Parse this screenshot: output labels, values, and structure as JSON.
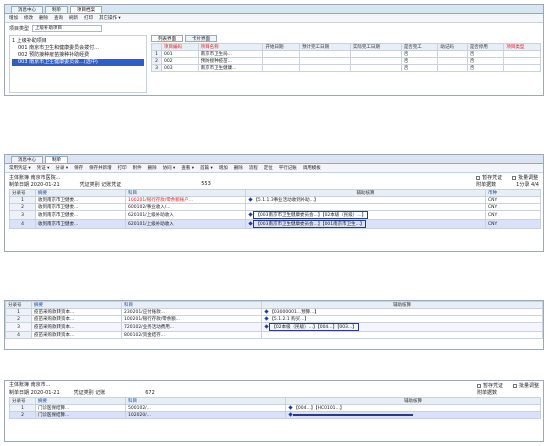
{
  "panel1": {
    "tabs": [
      "消息中心",
      "制单",
      "项目档案"
    ],
    "toolbar": [
      "增加",
      "修改",
      "删除",
      "查询",
      "刷新",
      "打印",
      "其它操作 ▾"
    ],
    "project_type_label": "项目类型",
    "project_type_value": "上级补助项目",
    "tree": [
      "1 上级补助项目",
      "001 南京市卫生和健康委员会拨付...",
      "002 预防接种疫苗接种补助经费",
      "003 南京市卫生健康委员会...(选中)"
    ],
    "subtabs": [
      "列表界面",
      "卡片界面"
    ],
    "grid_headers": [
      "项目编码",
      "项目名称",
      "开始日期",
      "预计完工日期",
      "实际完工日期",
      "是否完工",
      "助记码",
      "是否停用",
      "项目类型"
    ],
    "rows": [
      {
        "n": "1",
        "code": "001",
        "name": "南京市卫生局...",
        "flag": "否"
      },
      {
        "n": "2",
        "code": "002",
        "name": "预防接种疫苗...",
        "flag": "否"
      },
      {
        "n": "3",
        "code": "003",
        "name": "南京市卫生健康...",
        "flag": "否"
      }
    ]
  },
  "panel2": {
    "tabs": [
      "消息中心",
      "制单"
    ],
    "toolbar": [
      "常用凭证 ▾",
      "凭证 ▾",
      "分录 ▾",
      "保存",
      "保存并新增",
      "打印",
      "附件",
      "删除",
      "协同 ▾",
      "查看 ▾",
      "首篇 ▾",
      "增加",
      "删除",
      "流程",
      "定位",
      "平行记账",
      "调用模板"
    ],
    "entity": "主体账簿  南京市医院...",
    "date": "制单日期  2020-01-21",
    "doc_type": "凭证类别  记账凭证",
    "count": "553",
    "checkbox1": "暂存凭证",
    "checkbox2": "批量调整",
    "attach": "附单据数",
    "page": "1分录  4/4",
    "headers": [
      "分录号",
      "摘要",
      "科目",
      "辅助核算",
      "币种"
    ],
    "rows": [
      {
        "n": "1",
        "summary": "收到南京市卫健委...",
        "subject": "100201/银行存款/零余额账户...",
        "aux": "【5.1.1.3事业活动收到补助...】",
        "cur": "CNY"
      },
      {
        "n": "2",
        "summary": "收到南京市卫健委...",
        "subject": "600102/事业收入/...",
        "aux": "",
        "cur": "CNY"
      },
      {
        "n": "3",
        "summary": "收到南京市卫健委...",
        "subject": "620101/上级补助收入",
        "aux": "【003南京市卫生健康委员会...】【02本级（民级）...】",
        "cur": "CNY"
      },
      {
        "n": "4",
        "summary": "收到南京市卫健委...",
        "subject": "620101/上级补助收入",
        "aux": "【003南京市卫生健康委员会...】【001南京市卫生...】",
        "cur": "CNY"
      }
    ]
  },
  "panel3": {
    "headers": [
      "分录号",
      "摘要",
      "科目",
      "辅助核算"
    ],
    "rows": [
      {
        "n": "1",
        "summary": "疫苗采购款转资本...",
        "subject": "230201/应付账款...",
        "aux": "【03000001...预算...】"
      },
      {
        "n": "2",
        "summary": "疫苗采购款转资本...",
        "subject": "100201/银行存款/零余额...",
        "aux": "【5.1.2.1 购买...】"
      },
      {
        "n": "3",
        "summary": "疫苗采购款转资本...",
        "subject": "720102/业务活动费用...",
        "aux": "【02本级（民级）...】【004...】【003...】"
      },
      {
        "n": "4",
        "summary": "疫苗采购款转资本...",
        "subject": "800102/资金结存...",
        "aux": ""
      }
    ]
  },
  "panel4": {
    "entity": "主体账簿  南京市...",
    "doc_type": "凭证类别  记账",
    "count": "672",
    "date": "制单日期  2020-01-21",
    "checkbox1": "暂存凭证",
    "checkbox2": "批量调整",
    "attach": "附单据数",
    "headers": [
      "分录号",
      "摘要",
      "科目",
      "辅助核算"
    ],
    "rows": [
      {
        "n": "1",
        "summary": "门诊医保结算...",
        "subject": "500102/...",
        "aux": "【004...】【HC0101...】"
      },
      {
        "n": "2",
        "summary": "门诊医保结算...",
        "subject": "102020/...",
        "aux": ""
      }
    ]
  },
  "colors": {
    "accent": "#1a4fa0",
    "selected_row": "#d9e2f8",
    "tab_bar": "#dbe5f1",
    "alert": "#d22"
  }
}
